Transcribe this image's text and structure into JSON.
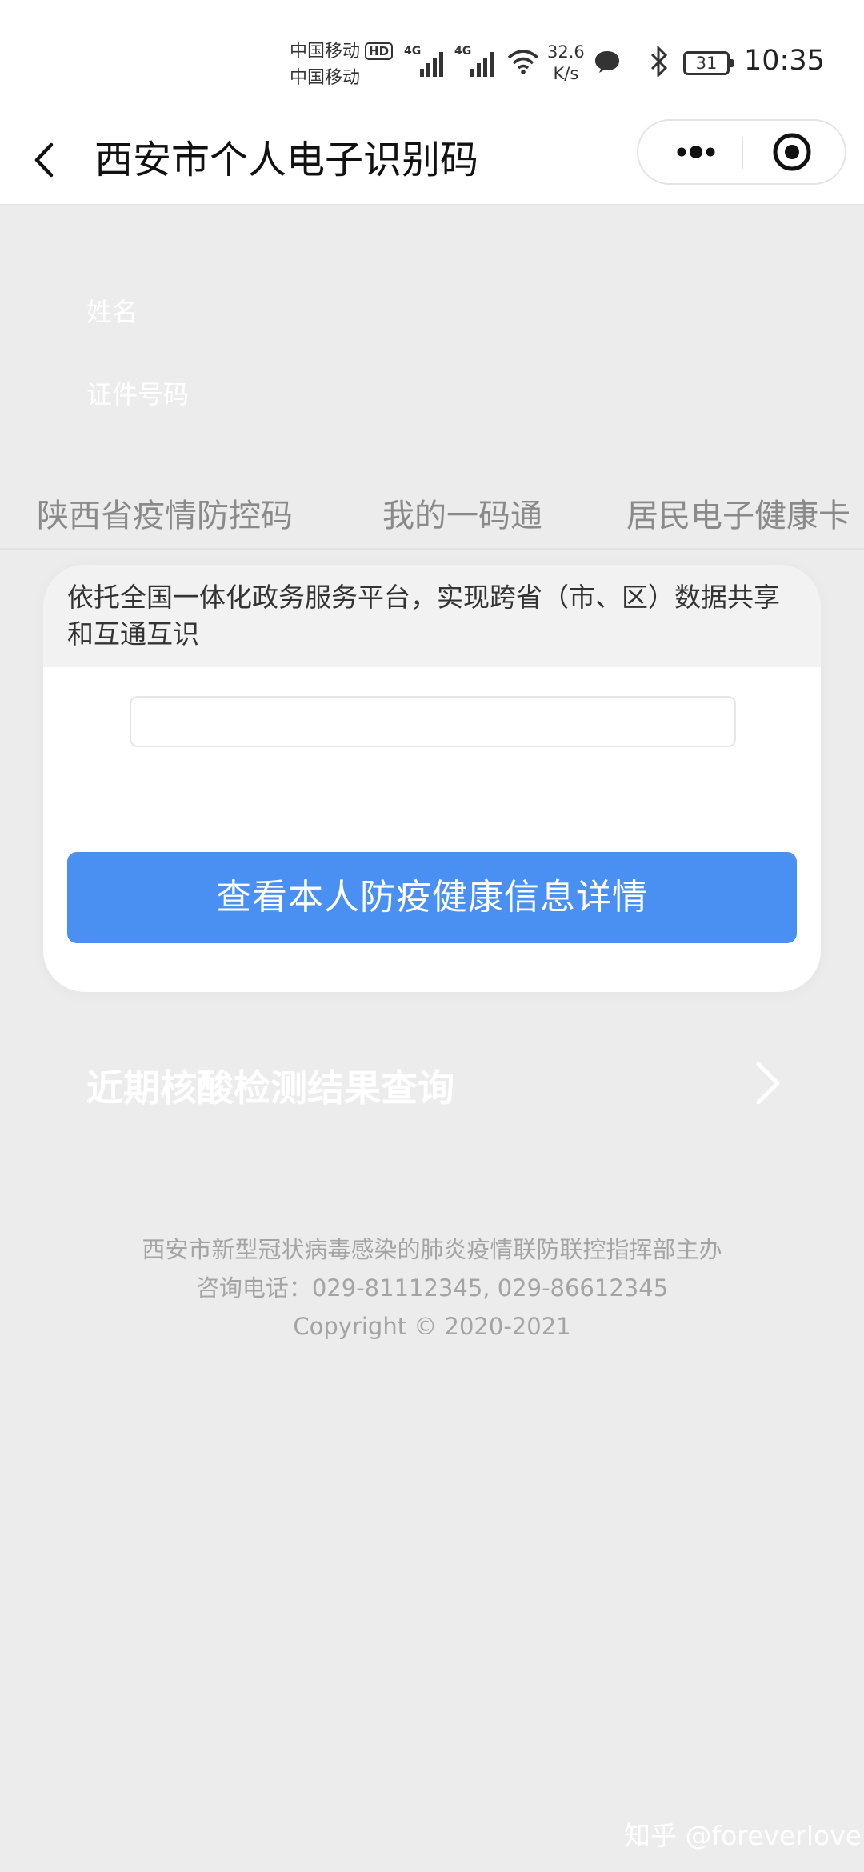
{
  "status_bar": {
    "carrier_1": "中国移动",
    "hd_badge": "HD",
    "carrier_2": "中国移动",
    "network_1": "4G",
    "network_2": "4G",
    "speed_value": "32.6",
    "speed_unit": "K/s",
    "battery": "31",
    "time": "10:35"
  },
  "header": {
    "title": "西安市个人电子识别码"
  },
  "info": {
    "name_label": "姓名",
    "id_label": "证件号码"
  },
  "tabs": [
    {
      "label": "陕西省疫情防控码"
    },
    {
      "label": "我的一码通"
    },
    {
      "label": "居民电子健康卡"
    }
  ],
  "card": {
    "note": "依托全国一体化政务服务平台，实现跨省（市、区）数据共享和互通互识",
    "button": "查看本人防疫健康信息详情"
  },
  "nucleic": {
    "label": "近期核酸检测结果查询"
  },
  "footer": {
    "organizer": "西安市新型冠状病毒感染的肺炎疫情联防联控指挥部主办",
    "phone": "咨询电话：029-81112345, 029-86612345",
    "copyright": "Copyright © 2020-2021"
  },
  "watermark": "知乎 @foreverlove",
  "colors": {
    "primary_button": "#4a8ff2",
    "page_background": "#ececec",
    "tab_text": "#8a8a8a",
    "footer_text": "#a4a4a4"
  },
  "icons": [
    "back-arrow-icon",
    "more-dots-icon",
    "target-close-icon",
    "chevron-right-icon",
    "wifi-icon",
    "message-icon",
    "bluetooth-icon"
  ]
}
